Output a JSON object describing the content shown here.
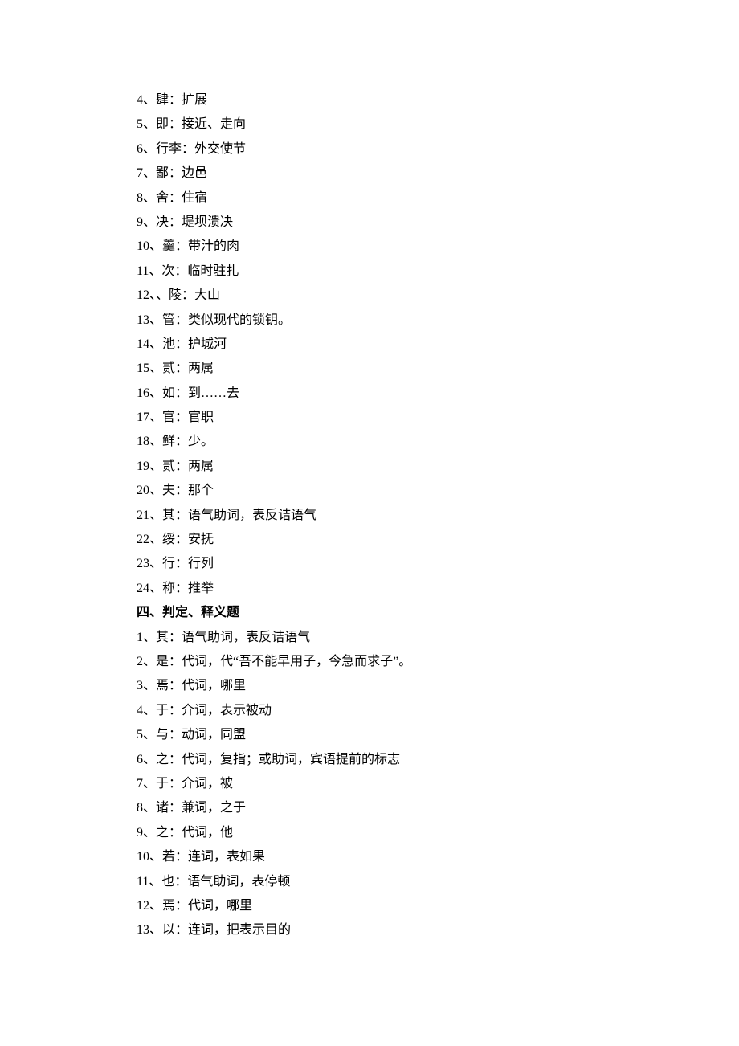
{
  "section3": {
    "items": [
      "4、肆：扩展",
      "5、即：接近、走向",
      "6、行李：外交使节",
      "7、鄙：边邑",
      "8、舍：住宿",
      "9、决：堤坝溃决",
      "10、羹：带汁的肉",
      "11、次：临时驻扎",
      "12、、陵：大山",
      "13、管：类似现代的锁钥。",
      "14、池：护城河",
      "15、贰：两属",
      "16、如：到……去",
      "17、官：官职",
      "18、鲜：少。",
      "19、贰：两属",
      "20、夫：那个",
      "21、其：语气助词，表反诘语气",
      "22、绥：安抚",
      "23、行：行列",
      "24、称：推举"
    ]
  },
  "section4": {
    "heading": "四、判定、释义题",
    "items": [
      "1、其：语气助词，表反诘语气",
      "2、是：代词，代“吾不能早用子，今急而求子”。",
      "3、焉：代词，哪里",
      "4、于：介词，表示被动",
      "5、与：动词，同盟",
      "6、之：代词，复指；或助词，宾语提前的标志",
      "7、于：介词，被",
      "8、诸：兼词，之于",
      "9、之：代词，他",
      "10、若：连词，表如果",
      "11、也：语气助词，表停顿",
      "12、焉：代词，哪里",
      "13、以：连词，把表示目的"
    ]
  }
}
